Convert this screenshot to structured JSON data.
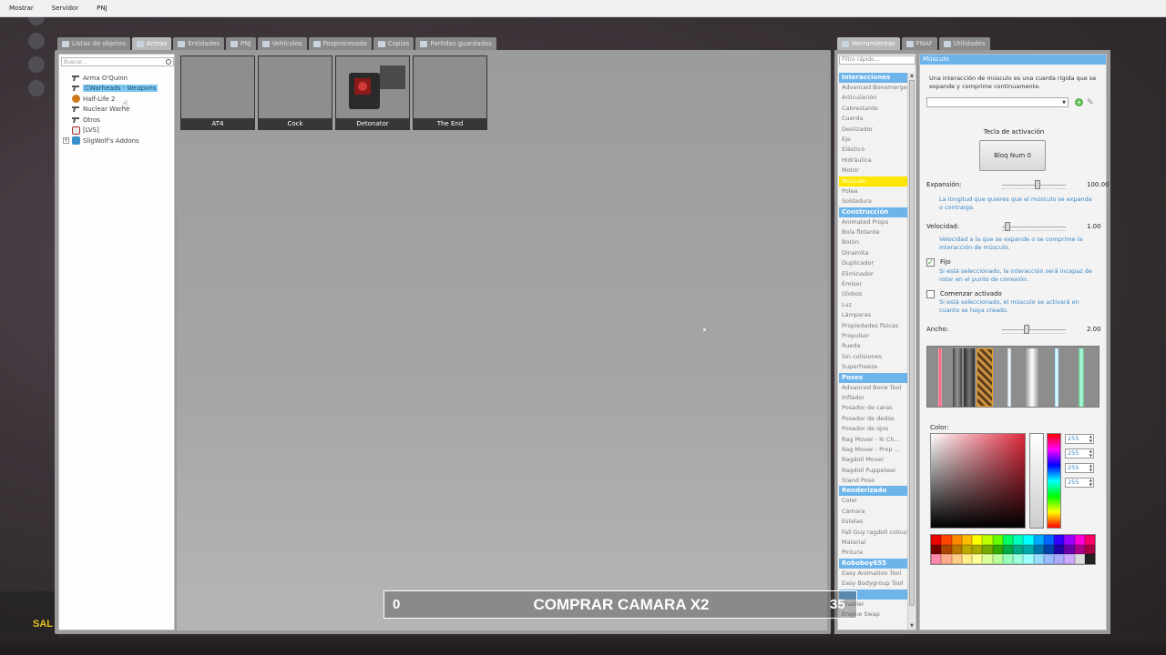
{
  "menubar": {
    "items": [
      "Mostrar",
      "Servidor",
      "PNJ"
    ]
  },
  "spawnmenu": {
    "tabs": [
      {
        "label": "Listas de objetos",
        "active": false
      },
      {
        "label": "Armas",
        "active": true
      },
      {
        "label": "Entidades",
        "active": false
      },
      {
        "label": "PNJ",
        "active": false
      },
      {
        "label": "Vehículos",
        "active": false
      },
      {
        "label": "Posprocesado",
        "active": false
      },
      {
        "label": "Copias",
        "active": false
      },
      {
        "label": "Partidas guardadas",
        "active": false
      }
    ],
    "search_placeholder": "Buscar...",
    "tree": [
      {
        "label": "Arma O'Quinn",
        "icon": "gun-icon",
        "expandable": false,
        "selected": false
      },
      {
        "label": "CWarheads - Weapons",
        "icon": "gun-icon",
        "expandable": true,
        "selected": true
      },
      {
        "label": "Half-Life 2",
        "icon": "hl2-icon",
        "expandable": false,
        "selected": false
      },
      {
        "label": "Nuclear Warhe",
        "icon": "gun-icon",
        "expandable": false,
        "selected": false
      },
      {
        "label": "Otros",
        "icon": "gun-icon",
        "expandable": false,
        "selected": false
      },
      {
        "label": "[LVS]",
        "icon": "lvs-icon",
        "expandable": false,
        "selected": false
      },
      {
        "label": "SligWolf's Addons",
        "icon": "sw-icon",
        "expandable": true,
        "selected": false
      }
    ],
    "spawnicons": [
      "AT4",
      "Cock",
      "Detonator",
      "The End"
    ]
  },
  "context": {
    "tabs": [
      {
        "label": "Herramientas",
        "active": true
      },
      {
        "label": "FNAF",
        "active": false
      },
      {
        "label": "Utilidades",
        "active": false
      }
    ],
    "quick_filter_placeholder": "Filtro rápido...",
    "categories": [
      {
        "header": "Interacciones",
        "items": [
          "Advanced Bonemerge",
          "Articulación",
          "Cabrestante",
          "Cuerda",
          "Deslizador",
          "Eje",
          "Elástico",
          "Hidráulica",
          "Motor",
          "Músculo",
          "Polea",
          "Soldadura"
        ],
        "selected": "Músculo"
      },
      {
        "header": "Construcción",
        "items": [
          "Animated Props",
          "Bola flotante",
          "Botón",
          "Dinamita",
          "Duplicador",
          "Eliminador",
          "Emisor",
          "Globos",
          "Luz",
          "Lámparas",
          "Propiedades físicas",
          "Propulsor",
          "Rueda",
          "Sin colisiones",
          "Superfreeze"
        ]
      },
      {
        "header": "Poses",
        "items": [
          "Advanced Bone Tool",
          "Inflador",
          "Posador de caras",
          "Posador de dedos",
          "Posador de ojos",
          "Rag Mover - Ik Ch...",
          "Rag Mover - Prop ...",
          "Ragdoll Mover",
          "Ragdoll Puppeteer",
          "Stand Pose"
        ]
      },
      {
        "header": "Renderizado",
        "items": [
          "Color",
          "Cámara",
          "Estelas",
          "Fall Guy ragdoll colour",
          "Material",
          "Pintura"
        ]
      },
      {
        "header": "Roboboy655",
        "items": [
          "Easy Animation Tool",
          "Easy Bodygroup Tool"
        ]
      },
      {
        "header": "",
        "items": [
          "Enabler",
          "Engine Swap"
        ]
      }
    ],
    "tool": {
      "title": "Músculo",
      "description": "Una interacción de músculo es una cuerda rígida que se expande y comprime continuamente.",
      "activation_label": "Tecla de activación",
      "activation_key": "Bloq Num 0",
      "expansion_label": "Expansión:",
      "expansion_value": "100.00",
      "expansion_fraction": 0.55,
      "expansion_help": "La longitud que quieres que el músculo se expanda o contraiga.",
      "speed_label": "Velocidad:",
      "speed_value": "1.00",
      "speed_fraction": 0.08,
      "speed_help": "Velocidad a la que se expande o se comprime la interacción de músculo.",
      "fixed_label": "Fijo",
      "fixed_checked": true,
      "fixed_help": "Si está seleccionado, la interacción será incapaz de rotar en el punto de conexión.",
      "start_on_label": "Comenzar activado",
      "start_on_checked": false,
      "start_on_help": "Si está seleccionado, el músculo se activará en cuanto se haya creado.",
      "width_label": "Ancho:",
      "width_value": "2.00",
      "width_fraction": 0.38,
      "color_label": "Color:",
      "rgba": [
        "255",
        "255",
        "255",
        "255"
      ]
    }
  },
  "hud": {
    "left_number": "0",
    "title": "COMPRAR CAMARA X2",
    "right_number": "35",
    "corner_text": "SAL"
  },
  "colors": {
    "accent": "#6cb4ea",
    "selected_tool": "#ffe600",
    "hud_text": "#ffffff"
  }
}
